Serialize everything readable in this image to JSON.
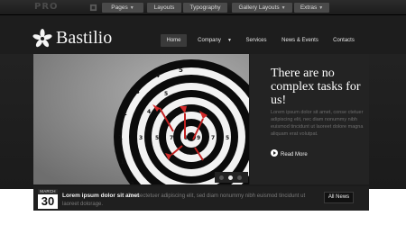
{
  "topbar": {
    "brand": "PRO",
    "items": [
      {
        "label": "Pages",
        "dropdown": true
      },
      {
        "label": "Layouts",
        "dropdown": false
      },
      {
        "label": "Typography",
        "dropdown": false
      },
      {
        "label": "Gallery Layouts",
        "dropdown": true
      },
      {
        "label": "Extras",
        "dropdown": true
      }
    ]
  },
  "header": {
    "logo_icon": "star-flower-icon",
    "site_name": "Bastilio",
    "nav": [
      {
        "label": "Home",
        "active": true
      },
      {
        "label": "Company",
        "active": false
      },
      {
        "label": "Services",
        "active": false
      },
      {
        "label": "News & Events",
        "active": false
      },
      {
        "label": "Contacts",
        "active": false
      }
    ],
    "dropdown_caret": "▼"
  },
  "slider": {
    "image_description": "dartboard with red darts",
    "headline": "There are no complex tasks for us!",
    "body": "Lorem ipsum dolor sit amet, conse ctetuer adipiscing elit, nec diam nonummy nibh euismod tincidunt ut laoreet dolore magna aliquam erat volutpat.",
    "read_more": "Read More",
    "slides_total": 3,
    "slide_current": 1
  },
  "news": {
    "month": "MARCH",
    "day": "30",
    "title": "Lorem ipsum dolor sit amet",
    "body": "Consectetuer adipiscing elit, sed diam nonummy nibh euismod tincidunt ut laoreet dolorage.",
    "all_news": "All News"
  },
  "colors": {
    "background_dark": "#1d1d1d",
    "active_nav": "#3a3a3a",
    "dart_red": "#c22222"
  }
}
